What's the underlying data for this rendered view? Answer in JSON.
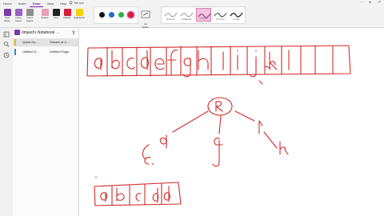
{
  "ribbon": {
    "tabs": [
      "Home",
      "Insert",
      "Draw",
      "View",
      "Help"
    ],
    "active_tab": "Draw",
    "tell_me": "Tell me",
    "tools": [
      {
        "label": "Type",
        "sub": "Mode"
      },
      {
        "label": "Lasso",
        "sub": "Select"
      },
      {
        "label": "Insert",
        "sub": "Space"
      },
      {
        "label": "Eraser",
        "sub": ""
      },
      {
        "label": "Pen",
        "sub": ""
      },
      {
        "label": "Marker",
        "sub": ""
      },
      {
        "label": "Highlighter",
        "sub": ""
      }
    ],
    "pen_colors": [
      "#111111",
      "#1f6fd6",
      "#2bb24c",
      "#d41c3a"
    ],
    "selected_pen_color": "#d41c3a",
    "ink_to_shape": {
      "label": "Ink",
      "sub": "Editor"
    },
    "shape_styles": [
      "0.5 mm",
      "0.35 mm",
      "0.5 mm",
      "0.7 mm",
      "1 mm"
    ]
  },
  "notebook": {
    "title": "rimjeet's Notebook",
    "sections": [
      {
        "label": "Quick No...",
        "page": "Stream of C...",
        "color": "#f4b400",
        "selected": true
      },
      {
        "label": "Untitled S...",
        "page": "Untitled Page",
        "color": "#1f8fd6",
        "selected": false
      }
    ]
  },
  "colors": {
    "ink": "#d12a2a",
    "accent": "#7719aa"
  }
}
